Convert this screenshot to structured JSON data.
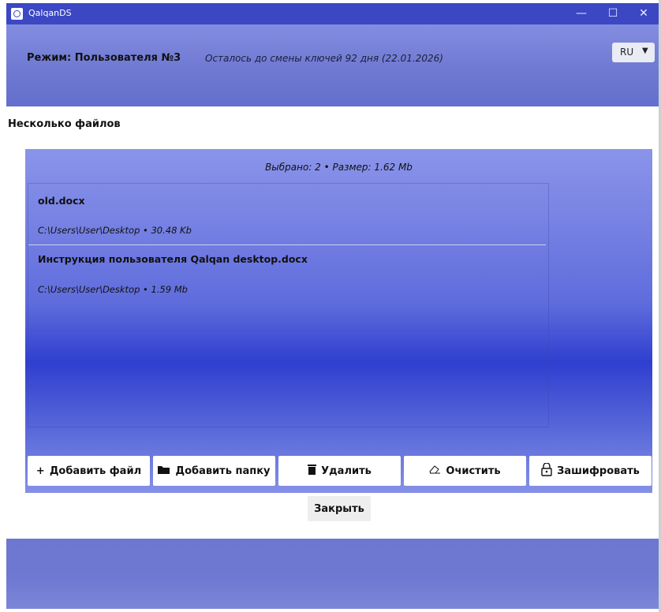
{
  "window": {
    "title": "QalqanDS"
  },
  "header": {
    "mode": "Режим: Пользователя №3",
    "keys_info": "Осталось до смены ключей 92 дня (22.01.2026)",
    "language": "RU"
  },
  "dialog": {
    "title": "Несколько файлов",
    "summary": "Выбрано: 2  •  Размер: 1.62 Mb",
    "files": [
      {
        "name": "old.docx",
        "meta": "C:\\Users\\User\\Desktop  •  30.48 Kb"
      },
      {
        "name": "Инструкция пользователя Qalqan desktop.docx",
        "meta": "C:\\Users\\User\\Desktop  •  1.59 Mb"
      }
    ],
    "buttons": {
      "add_file": "Добавить файл",
      "add_folder": "Добавить папку",
      "delete": "Удалить",
      "clear": "Очистить",
      "encrypt": "Зашифровать",
      "close": "Закрыть"
    },
    "icons": {
      "add_file": "+",
      "add_folder": "folder-icon",
      "delete": "trash-icon",
      "clear": "eraser-icon",
      "encrypt": "lock-icon"
    }
  },
  "colors": {
    "titlebar": "#3b47c3",
    "accent": "#5f6cdc"
  }
}
